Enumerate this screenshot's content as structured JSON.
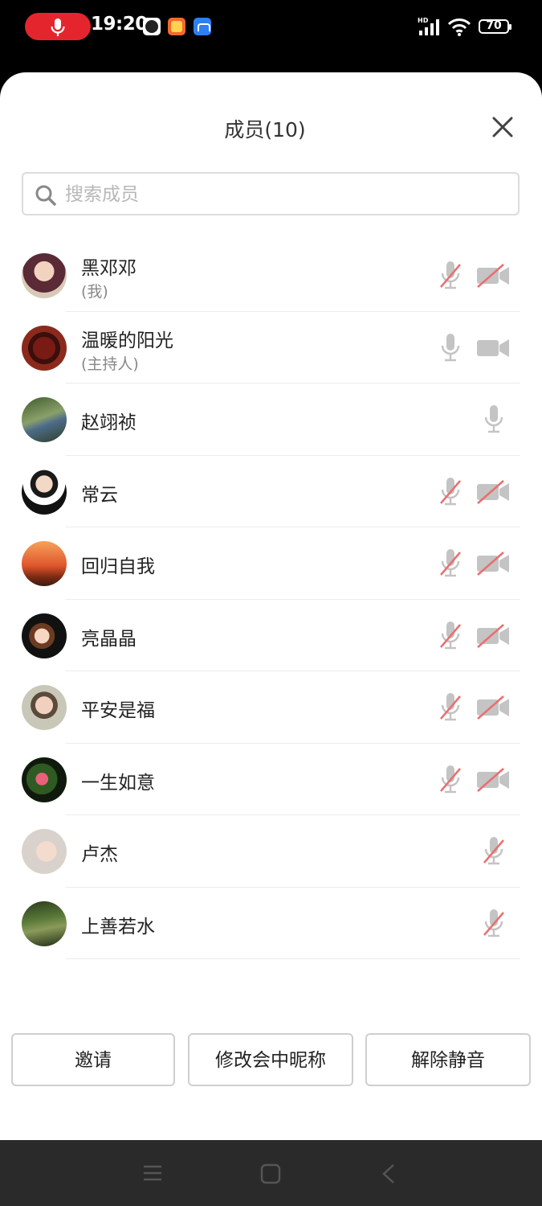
{
  "status_bar": {
    "time": "19:20",
    "battery": "70"
  },
  "dialog": {
    "title": "成员(10)",
    "search_placeholder": "搜索成员"
  },
  "members": [
    {
      "name": "黑邓邓",
      "role": "(我)",
      "mic": "muted",
      "camera": "off"
    },
    {
      "name": "温暖的阳光",
      "role": "(主持人)",
      "mic": "on",
      "camera": "on"
    },
    {
      "name": "赵翊祯",
      "role": "",
      "mic": "on",
      "camera": "none"
    },
    {
      "name": "常云",
      "role": "",
      "mic": "muted",
      "camera": "off"
    },
    {
      "name": "回归自我",
      "role": "",
      "mic": "muted",
      "camera": "off"
    },
    {
      "name": "亮晶晶",
      "role": "",
      "mic": "muted",
      "camera": "off"
    },
    {
      "name": "平安是福",
      "role": "",
      "mic": "muted",
      "camera": "off"
    },
    {
      "name": "一生如意",
      "role": "",
      "mic": "muted",
      "camera": "off"
    },
    {
      "name": "卢杰",
      "role": "",
      "mic": "muted",
      "camera": "none"
    },
    {
      "name": "上善若水",
      "role": "",
      "mic": "muted",
      "camera": "none"
    }
  ],
  "actions": {
    "invite": "邀请",
    "rename": "修改会中昵称",
    "unmute": "解除静音"
  }
}
